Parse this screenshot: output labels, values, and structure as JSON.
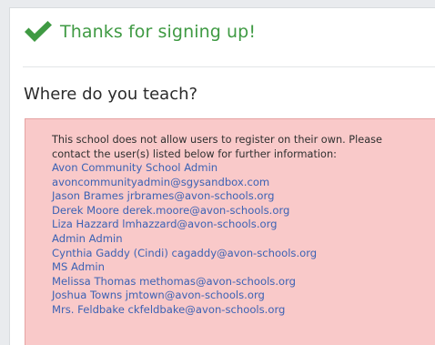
{
  "confirmation": {
    "icon": "check-icon",
    "color": "#3f9a43",
    "title": "Thanks for signing up!"
  },
  "school_prompt": {
    "heading": "Where do you teach?"
  },
  "alert": {
    "background": "#f9c9c9",
    "message_line_1": "This school does not allow users to register on their own. Please",
    "message_line_2": "contact the user(s) listed below for further information:",
    "contacts": [
      "Avon Community School Admin",
      "avoncommunityadmin@sgysandbox.com",
      "Jason Brames jrbrames@avon-schools.org",
      "Derek Moore derek.moore@avon-schools.org",
      "Liza Hazzard lmhazzard@avon-schools.org",
      "Admin Admin",
      "Cynthia Gaddy (Cindi) cagaddy@avon-schools.org",
      "MS Admin",
      "Melissa Thomas methomas@avon-schools.org",
      "Joshua Towns jmtown@avon-schools.org",
      "Mrs. Feldbake ckfeldbake@avon-schools.org"
    ]
  }
}
